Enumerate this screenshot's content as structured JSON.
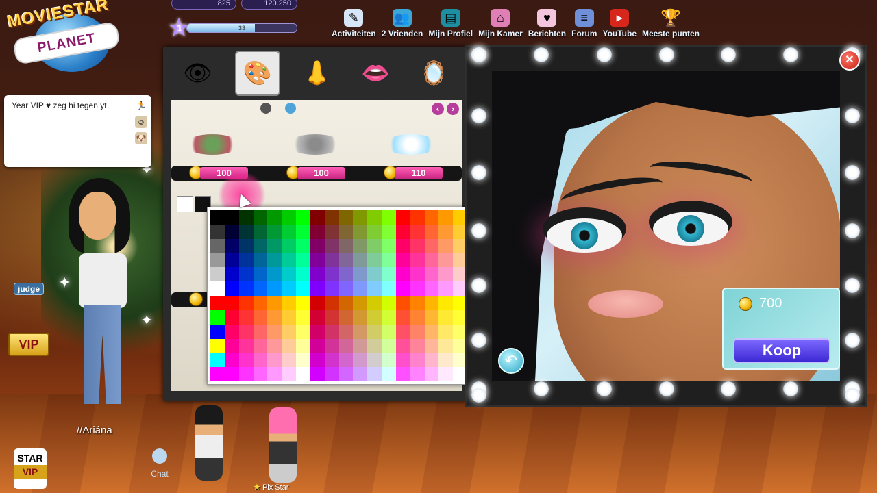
{
  "app": {
    "title": "MovieStarPlanet",
    "logo_line1": "MOVIESTAR",
    "logo_line2": "PLANET"
  },
  "hud": {
    "diamonds": "825",
    "starcoins": "120.250",
    "level": "1",
    "xp_text": "33",
    "xp_fraction": 0.62
  },
  "nav": [
    {
      "label": "Activiteiten",
      "icon": "activities-icon"
    },
    {
      "label": "2 Vrienden",
      "icon": "friends-icon"
    },
    {
      "label": "Mijn Profiel",
      "icon": "profile-icon"
    },
    {
      "label": "Mijn Kamer",
      "icon": "room-icon"
    },
    {
      "label": "Berichten",
      "icon": "messages-icon"
    },
    {
      "label": "Forum",
      "icon": "forum-icon"
    },
    {
      "label": "YouTube",
      "icon": "youtube-icon"
    },
    {
      "label": "Meeste punten",
      "icon": "trophy-icon"
    }
  ],
  "chat_bubble": {
    "message": "Year VIP ♥ zeg hi tegen yt"
  },
  "badges": {
    "judge": "judge",
    "vip": "VIP",
    "star": "STAR",
    "star_vip": "VIP"
  },
  "room": {
    "username": "//Ariána",
    "chat_label": "Chat",
    "pix_label": "Pix Star"
  },
  "makeup": {
    "tabs": [
      "eyes",
      "eyeshadow",
      "nose",
      "lips",
      "powder"
    ],
    "active_tab": "eyeshadow",
    "row1_prices": [
      "100",
      "100",
      "110"
    ]
  },
  "preview": {
    "price": "700",
    "buy_label": "Koop"
  },
  "colors": {
    "accent": "#b73d9d",
    "buy": "#4b39e6",
    "close": "#d0271a"
  }
}
